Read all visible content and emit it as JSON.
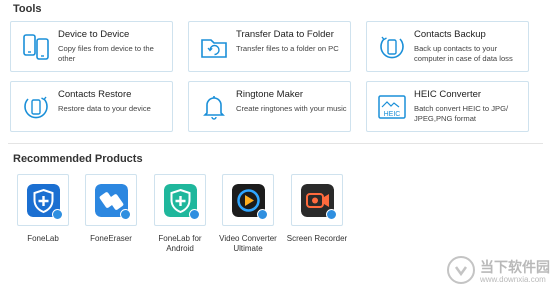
{
  "tools": {
    "title": "Tools",
    "cards": [
      {
        "name": "Device to Device",
        "desc": "Copy files from device to the other",
        "icon": "phones-icon"
      },
      {
        "name": "Transfer Data to Folder",
        "desc": "Transfer files to a folder on PC",
        "icon": "folder-sync-icon"
      },
      {
        "name": "Contacts Backup",
        "desc": "Back up contacts to your computer in case of data loss",
        "icon": "contacts-backup-icon"
      },
      {
        "name": "Contacts Restore",
        "desc": "Restore data to your device",
        "icon": "contacts-restore-icon"
      },
      {
        "name": "Ringtone Maker",
        "desc": "Create ringtones with your music",
        "icon": "bell-icon"
      },
      {
        "name": "HEIC Converter",
        "desc": "Batch convert HEIC to JPG/ JPEG,PNG format",
        "icon": "heic-icon"
      }
    ]
  },
  "recommended": {
    "title": "Recommended Products",
    "products": [
      {
        "label": "FoneLab",
        "icon": "fonelab-icon",
        "color": "#1b6fd1"
      },
      {
        "label": "FoneEraser",
        "icon": "foneeraser-icon",
        "color": "#2c87e0"
      },
      {
        "label": "FoneLab for Android",
        "icon": "fonelab-android-icon",
        "color": "#1fb79c"
      },
      {
        "label": "Video Converter Ultimate",
        "icon": "video-converter-icon",
        "color": "#1c1c1c"
      },
      {
        "label": "Screen Recorder",
        "icon": "screen-recorder-icon",
        "color": "#2a2a2a"
      }
    ]
  },
  "watermark": {
    "text": "当下软件园",
    "url": "www.downxia.com"
  },
  "colors": {
    "accent": "#1a8fd8",
    "card_border": "#cfe2ee"
  }
}
